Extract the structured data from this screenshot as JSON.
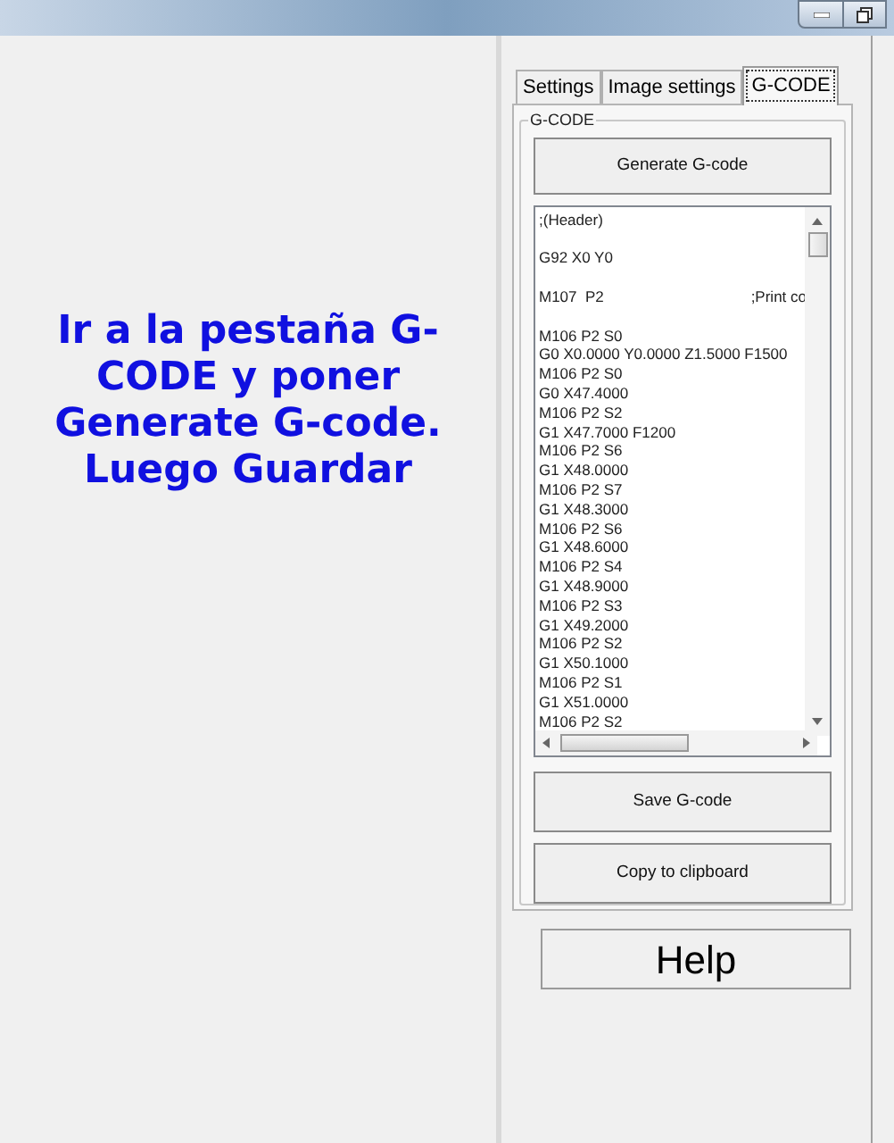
{
  "annotation": "Ir a la pestaña G-CODE y poner Generate G-code. Luego Guardar",
  "tabs": [
    {
      "label": "Settings",
      "selected": false
    },
    {
      "label": "Image settings",
      "selected": false
    },
    {
      "label": "G-CODE",
      "selected": true
    }
  ],
  "group": {
    "title": "G-CODE",
    "generate_button": "Generate G-code",
    "code_blocks": [
      [
        {
          "text": ";(Header)"
        }
      ],
      [
        {
          "text": "G92 X0 Y0"
        }
      ],
      [
        {
          "text": "M107  P2",
          "comment": ";Print co"
        }
      ],
      [
        {
          "text": "M106 P2 S0"
        },
        {
          "text": "G0 X0.0000 Y0.0000 Z1.5000 F1500"
        },
        {
          "text": "M106 P2 S0"
        },
        {
          "text": "G0 X47.4000"
        },
        {
          "text": "M106 P2 S2"
        },
        {
          "text": "G1 X47.7000 F1200"
        },
        {
          "text": "M106 P2 S6"
        },
        {
          "text": "G1 X48.0000"
        },
        {
          "text": "M106 P2 S7"
        },
        {
          "text": "G1 X48.3000"
        },
        {
          "text": "M106 P2 S6"
        },
        {
          "text": "G1 X48.6000"
        },
        {
          "text": "M106 P2 S4"
        },
        {
          "text": "G1 X48.9000"
        },
        {
          "text": "M106 P2 S3"
        },
        {
          "text": "G1 X49.2000"
        },
        {
          "text": "M106 P2 S2"
        },
        {
          "text": "G1 X50.1000"
        },
        {
          "text": "M106 P2 S1"
        },
        {
          "text": "G1 X51.0000"
        },
        {
          "text": "M106 P2 S2"
        }
      ]
    ],
    "save_button": "Save G-code",
    "copy_button": "Copy to clipboard"
  },
  "help_button": "Help"
}
